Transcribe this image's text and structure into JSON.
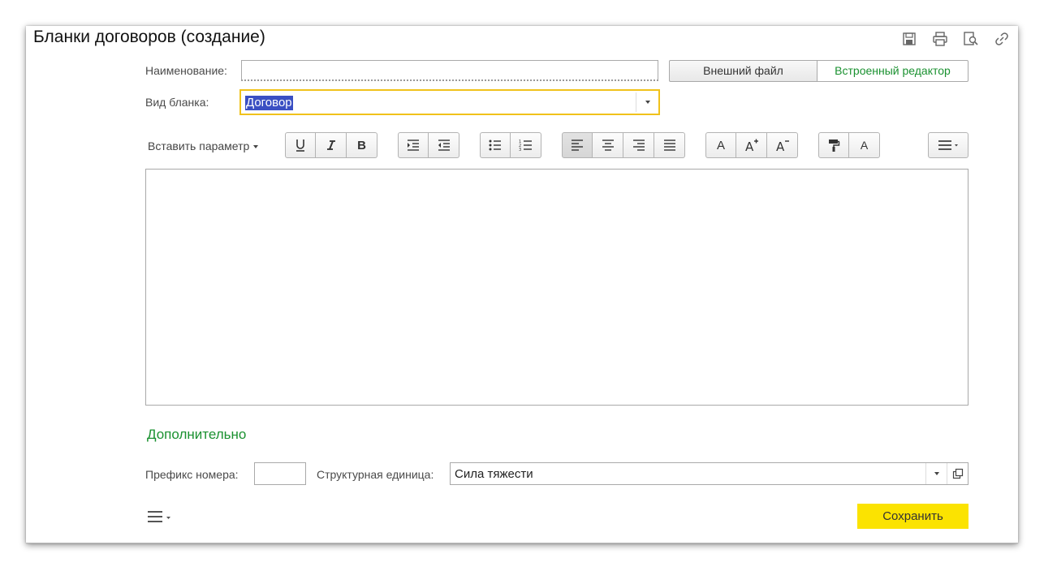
{
  "title": "Бланки договоров (создание)",
  "form": {
    "name_label": "Наименование:",
    "name_value": "",
    "external_file": "Внешний файл",
    "builtin_editor": "Встроенный редактор",
    "kind_label": "Вид бланка:",
    "kind_value": "Договор"
  },
  "toolbar": {
    "insert_param": "Вставить параметр",
    "bold": "B",
    "font_letter": "A"
  },
  "extra": {
    "section_title": "Дополнительно",
    "prefix_label": "Префикс номера:",
    "prefix_value": "",
    "unit_label": "Структурная единица:",
    "unit_value": "Сила тяжести"
  },
  "actions": {
    "save": "Сохранить"
  },
  "colors": {
    "accent_green": "#1a9130",
    "save_yellow": "#fbe301",
    "focus_border": "#f0c21b",
    "selection_blue": "#3a4fc3"
  }
}
